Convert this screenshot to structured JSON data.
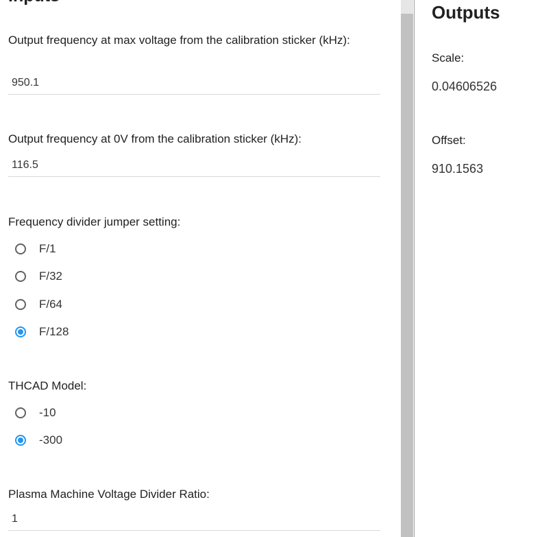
{
  "inputs": {
    "title": "Inputs",
    "freq_max": {
      "label": "Output frequency at max voltage from the calibration sticker (kHz):",
      "value": "950.1"
    },
    "freq_zero": {
      "label": "Output frequency at 0V from the calibration sticker (kHz):",
      "value": "116.5"
    },
    "divider": {
      "label": "Frequency divider jumper setting:",
      "options": [
        "F/1",
        "F/32",
        "F/64",
        "F/128"
      ],
      "selected": "F/128"
    },
    "model": {
      "label": "THCAD Model:",
      "options": [
        "-10",
        "-300"
      ],
      "selected": "-300"
    },
    "voltage_ratio": {
      "label": "Plasma Machine Voltage Divider Ratio:",
      "value": "1"
    }
  },
  "outputs": {
    "title": "Outputs",
    "scale_label": "Scale:",
    "scale_value": "0.04606526",
    "offset_label": "Offset:",
    "offset_value": "910.1563"
  },
  "colors": {
    "accent": "#2196f3",
    "radio_unchecked": "#616161",
    "scrollbar_thumb": "#c1c1c1"
  }
}
